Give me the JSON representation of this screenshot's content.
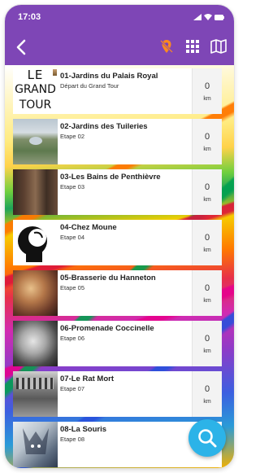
{
  "status": {
    "time": "17:03"
  },
  "nav": {
    "back_icon": "back-arrow-icon",
    "actions": [
      "pin-off-icon",
      "grid-icon",
      "map-icon"
    ]
  },
  "logo": {
    "line1": "LE",
    "line2": "GRAND",
    "line3": "TOUR"
  },
  "stages": [
    {
      "title": "01-Jardins du Palais Royal",
      "subtitle": "Départ du Grand Tour",
      "distance": "0",
      "unit": "km"
    },
    {
      "title": "02-Jardins des Tuileries",
      "subtitle": "Etape 02",
      "distance": "0",
      "unit": "km"
    },
    {
      "title": "03-Les Bains de Penthièvre",
      "subtitle": "Etape 03",
      "distance": "0",
      "unit": "km"
    },
    {
      "title": "04-Chez Moune",
      "subtitle": "Etape 04",
      "distance": "0",
      "unit": "km"
    },
    {
      "title": "05-Brasserie du Hanneton",
      "subtitle": "Etape 05",
      "distance": "0",
      "unit": "km"
    },
    {
      "title": "06-Promenade Coccinelle",
      "subtitle": "Etape 06",
      "distance": "0",
      "unit": "km"
    },
    {
      "title": "07-Le Rat Mort",
      "subtitle": "Etape 07",
      "distance": "0",
      "unit": "km"
    },
    {
      "title": "08-La Souris",
      "subtitle": "Etape 08",
      "distance": "",
      "unit": ""
    }
  ],
  "colors": {
    "header": "#7e46b6",
    "fab": "#2cb3e8"
  },
  "fab": {
    "icon": "search-icon"
  }
}
